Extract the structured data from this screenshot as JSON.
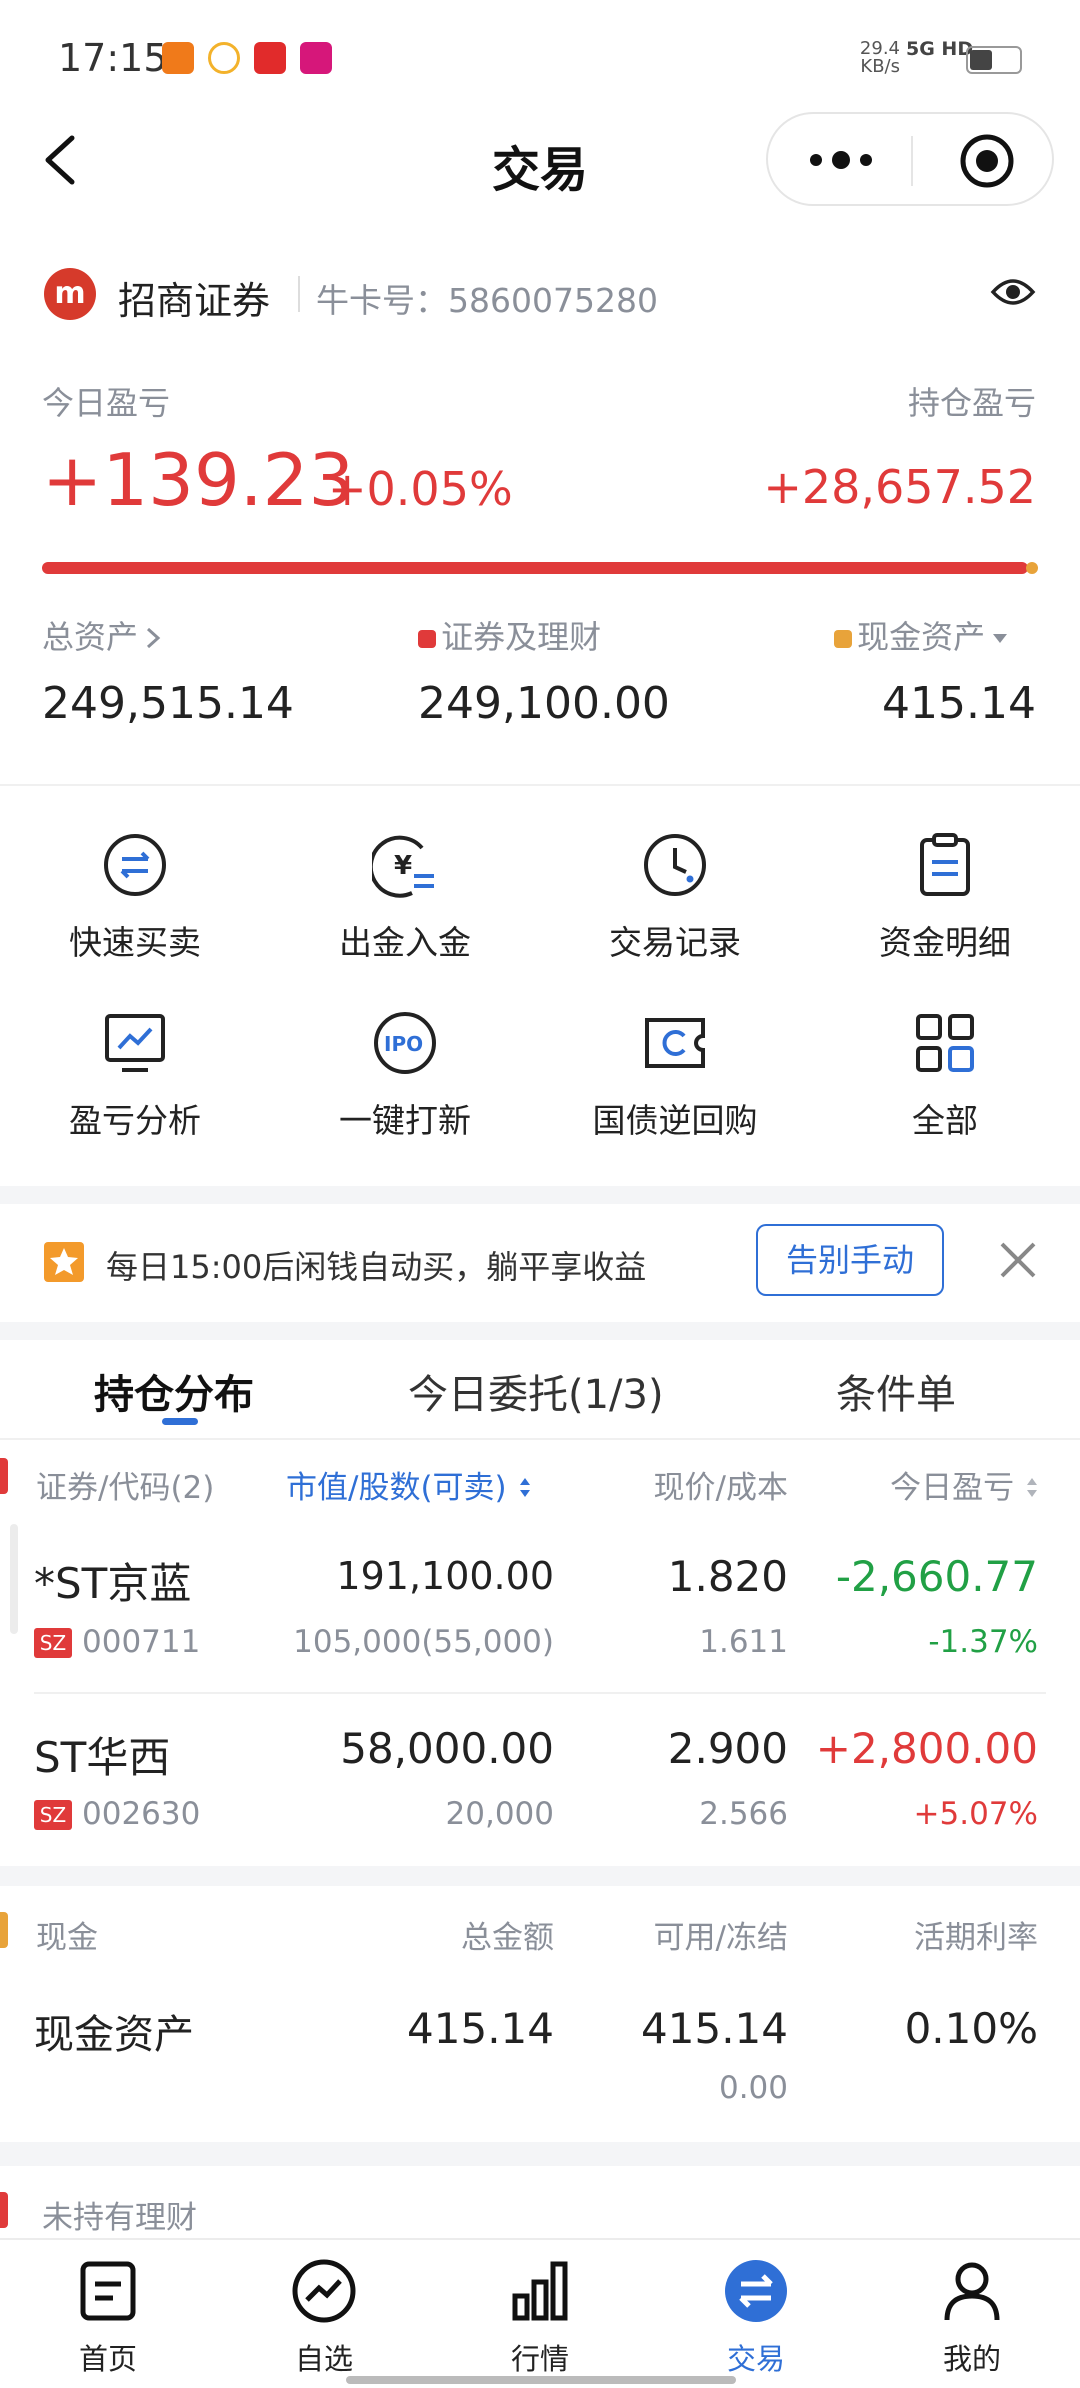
{
  "status": {
    "time": "17:15",
    "net_speed_value": "29.4",
    "net_speed_unit": "KB/s",
    "network": "5G HD"
  },
  "nav": {
    "title": "交易"
  },
  "account": {
    "broker": "招商证券",
    "card_label": "牛卡号：",
    "card_no": "5860075280"
  },
  "pnl": {
    "today_label": "今日盈亏",
    "today_value": "+139.23",
    "today_pct": "+0.05%",
    "hold_label": "持仓盈亏",
    "hold_value": "+28,657.52",
    "securities_share": 0.998
  },
  "assets": {
    "total_label": "总资产",
    "total_value": "249,515.14",
    "securities_label": "证券及理财",
    "securities_value": "249,100.00",
    "cash_label": "现金资产",
    "cash_value": "415.14"
  },
  "grid": [
    {
      "label": "快速买卖",
      "icon": "swap-icon"
    },
    {
      "label": "出金入金",
      "icon": "yuan-transfer-icon"
    },
    {
      "label": "交易记录",
      "icon": "clock-icon"
    },
    {
      "label": "资金明细",
      "icon": "clipboard-icon"
    },
    {
      "label": "盈亏分析",
      "icon": "chart-monitor-icon"
    },
    {
      "label": "一键打新",
      "icon": "ipo-icon"
    },
    {
      "label": "国债逆回购",
      "icon": "bond-repo-icon"
    },
    {
      "label": "全部",
      "icon": "all-grid-icon"
    }
  ],
  "banner": {
    "text": "每日15:00后闲钱自动买，躺平享收益",
    "button": "告别手动"
  },
  "tabs": [
    {
      "label": "持仓分布",
      "active": true
    },
    {
      "label": "今日委托(1/3)",
      "active": false
    },
    {
      "label": "条件单",
      "active": false
    }
  ],
  "holdings": {
    "headers": {
      "code": "证券/代码(2)",
      "value": "市值/股数(可卖)",
      "price": "现价/成本",
      "pnl": "今日盈亏"
    },
    "rows": [
      {
        "name": "*ST京蓝",
        "market": "SZ",
        "code": "000711",
        "value": "191,100.00",
        "shares": "105,000(55,000)",
        "price": "1.820",
        "cost": "1.611",
        "pnl": "-2,660.77",
        "pnl_pct": "-1.37%",
        "up": false
      },
      {
        "name": "ST华西",
        "market": "SZ",
        "code": "002630",
        "value": "58,000.00",
        "shares": "20,000",
        "price": "2.900",
        "cost": "2.566",
        "pnl": "+2,800.00",
        "pnl_pct": "+5.07%",
        "up": true
      }
    ]
  },
  "cash": {
    "headers": {
      "name": "现金",
      "total": "总金额",
      "avail": "可用/冻结",
      "rate": "活期利率"
    },
    "row": {
      "name": "现金资产",
      "total": "415.14",
      "avail": "415.14",
      "frozen": "0.00",
      "rate": "0.10%"
    }
  },
  "wealth": {
    "label": "未持有理财"
  },
  "bottom_nav": [
    {
      "label": "首页",
      "icon": "home-icon",
      "active": false
    },
    {
      "label": "自选",
      "icon": "watchlist-icon",
      "active": false
    },
    {
      "label": "行情",
      "icon": "market-icon",
      "active": false
    },
    {
      "label": "交易",
      "icon": "trade-icon",
      "active": true
    },
    {
      "label": "我的",
      "icon": "profile-icon",
      "active": false
    }
  ],
  "colors": {
    "red": "#e03a3a",
    "green": "#21a045",
    "blue": "#2f6fd6",
    "gold": "#e8a33a"
  }
}
